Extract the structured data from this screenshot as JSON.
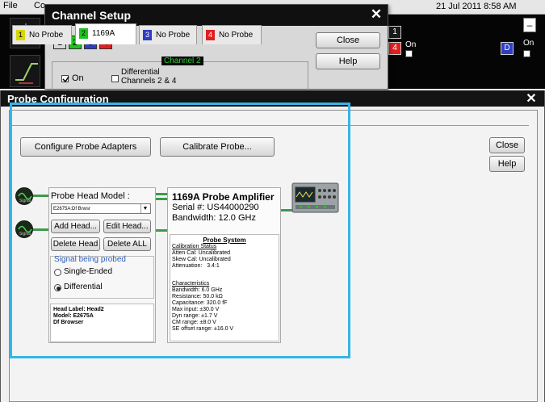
{
  "menubar": {
    "file": "File",
    "control_partial": "Co",
    "datetime": "21 Jul 2011  8:58 AM"
  },
  "app": {
    "channel_on_label_a": "On",
    "channel_on_label_b": "On",
    "channel_d_chip": "D",
    "channel_4_chip": "4",
    "channel_1_chip": "1",
    "minimize_glyph": "–"
  },
  "channel_setup": {
    "title": "Channel Setup",
    "channels": [
      {
        "label": "1",
        "color": "#d8d800"
      },
      {
        "label": "2",
        "color": "#1fc21f"
      },
      {
        "label": "3",
        "color": "#2f3ec2"
      },
      {
        "label": "4",
        "color": "#e02020"
      }
    ],
    "close_label": "Close",
    "help_label": "Help",
    "on_label": "On",
    "differential_label": "Differential",
    "differential_sub": "Channels 2 & 4",
    "group_label": "Channel 2"
  },
  "probe_config": {
    "title": "Probe Configuration",
    "tabs": [
      {
        "num": "1",
        "label": "No Probe",
        "color": "#d8d800"
      },
      {
        "num": "2",
        "label": "1169A",
        "color": "#1fc21f"
      },
      {
        "num": "3",
        "label": "No Probe",
        "color": "#2f3ec2"
      },
      {
        "num": "4",
        "label": "No Probe",
        "color": "#e02020"
      }
    ],
    "configure_adapters_label": "Configure Probe Adapters",
    "calibrate_label": "Calibrate Probe...",
    "close_label": "Close",
    "help_label": "Help",
    "signal_icon_text": "Signal",
    "probe_head_model_label": "Probe Head Model :",
    "probe_head_model_value": "E2675A:Df Brwsr",
    "add_head_label": "Add Head...",
    "edit_head_label": "Edit Head...",
    "delete_head_label": "Delete Head",
    "delete_all_label": "Delete ALL",
    "signal_probed_label": "Signal being probed",
    "single_ended_label": "Single-Ended",
    "differential_label": "Differential",
    "selected_mode": "Differential",
    "head_label_line1": "Head Label: Head2",
    "head_label_line2": "Model: E2675A",
    "head_label_line3": "Df Browser",
    "amp_title": "1169A Probe Amplifier",
    "amp_serial": "Serial #: US44000290",
    "amp_bandwidth": "Bandwidth: 12.0 GHz",
    "probe_system_title": "Probe System",
    "calibration_status_heading": "Calibration Status",
    "atten_cal": "Atten Cal: Uncalibrated",
    "skew_cal": "Skew Cal: Uncalibrated",
    "attenuation": "Attenuation:   3.4:1",
    "characteristics_heading": "Characteristics",
    "ch_bandwidth": "Bandwidth: 6.0 GHz",
    "ch_resistance": "Resistance: 50.0 kΩ",
    "ch_capacitance": "Capacitance: 320.0 fF",
    "ch_max_input": "Max input: ±30.0 V",
    "ch_dyn_range": "Dyn range: ±1.7 V",
    "ch_cm_range": "CM range: ±8.0 V",
    "ch_se_offset": "SE offset range: ±16.0 V"
  }
}
